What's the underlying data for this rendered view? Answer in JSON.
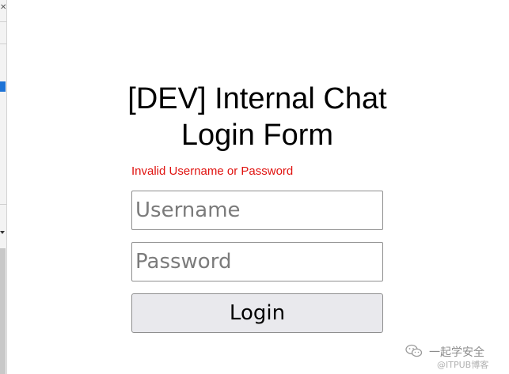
{
  "left_panel": {
    "close_glyph": "✕"
  },
  "form": {
    "title_line1": "[DEV] Internal Chat",
    "title_line2": "Login Form",
    "error_message": "Invalid Username or Password",
    "username_placeholder": "Username",
    "password_placeholder": "Password",
    "login_label": "Login"
  },
  "watermark": {
    "name": "一起学安全",
    "source": "@ITPUB博客",
    "icon": "wechat-icon"
  },
  "colors": {
    "error": "#e0120f",
    "button_bg": "#e9e9ed",
    "selection": "#1e73d6"
  }
}
